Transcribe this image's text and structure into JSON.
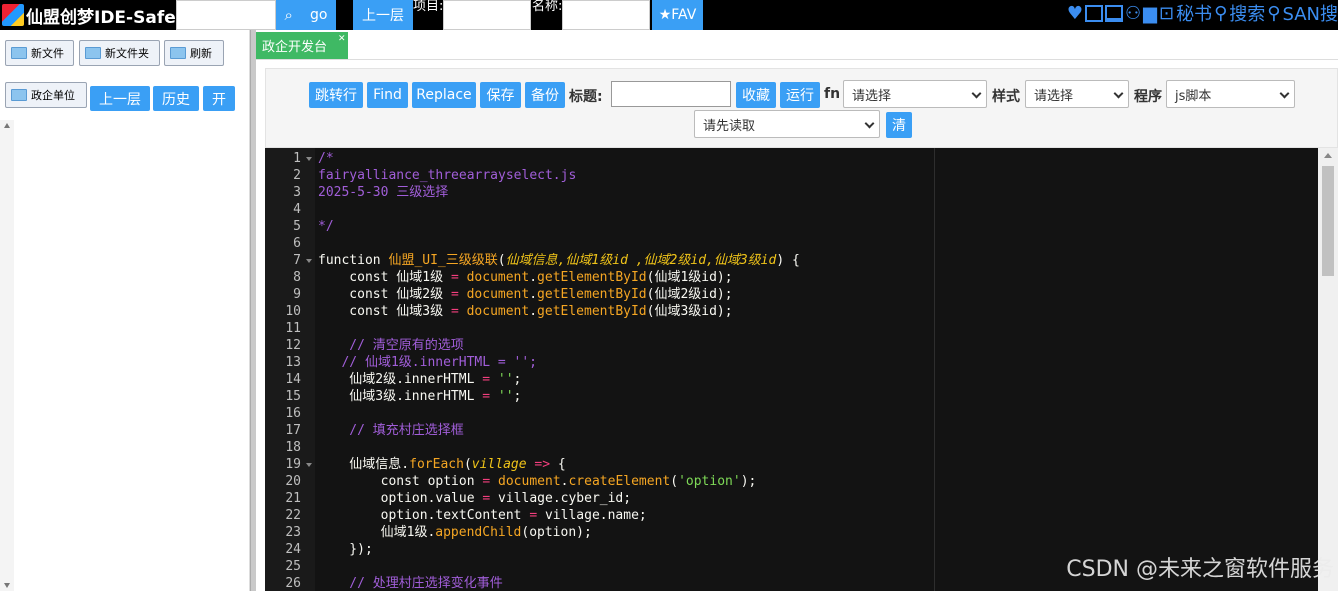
{
  "app": {
    "brand": "仙盟创梦IDE-Safe",
    "search_btn": "go",
    "up_btn": "上一层",
    "project_label": "项目:",
    "name_label": "名称:",
    "fav_btn": "★FAV",
    "right_icons": [
      "heart-icon",
      "panel-icon",
      "window-icon",
      "user-icon",
      "folder-icon",
      "briefcase-icon"
    ],
    "secret_book": "秘书",
    "search_link": "搜索",
    "san_search": "SAN搜"
  },
  "left": {
    "new_file": "新文件",
    "new_folder": "新文件夹",
    "refresh": "刷新",
    "unit": "政企单位",
    "up": "上一层",
    "history": "历史",
    "open": "开"
  },
  "tabs": [
    {
      "label": "政企开发台"
    }
  ],
  "toolbar": {
    "goto": "跳转行",
    "find": "Find",
    "replace": "Replace",
    "save": "保存",
    "backup": "备份",
    "title_label": "标题:",
    "collect": "收藏",
    "run": "运行",
    "fn_label": "fn",
    "fn_select": "请选择",
    "style_label": "样式",
    "style_select": "请选择",
    "program_label": "程序",
    "program_select": "js脚本",
    "read_select": "请先读取",
    "clear": "清"
  },
  "editor": {
    "lines": [
      {
        "n": "1",
        "t": [
          [
            "cm",
            "/*"
          ]
        ]
      },
      {
        "n": "2",
        "t": [
          [
            "cm",
            "fairyalliance_threearrayselect.js"
          ]
        ]
      },
      {
        "n": "3",
        "t": [
          [
            "cm",
            "2025-5-30 三级选择"
          ]
        ]
      },
      {
        "n": "4",
        "t": [
          [
            "cm",
            ""
          ]
        ]
      },
      {
        "n": "5",
        "t": [
          [
            "cm",
            "*/"
          ]
        ]
      },
      {
        "n": "6",
        "t": []
      },
      {
        "n": "7",
        "t": [
          [
            "kw",
            "function "
          ],
          [
            "fn",
            "仙盟_UI_三级级联"
          ],
          [
            "kw",
            "("
          ],
          [
            "pa",
            "仙域信息,仙域1级id ,仙域2级id,仙域3级id"
          ],
          [
            "kw",
            ") {"
          ]
        ]
      },
      {
        "n": "8",
        "t": [
          [
            "kw",
            "    const "
          ],
          [
            "vr",
            "仙域1级 "
          ],
          [
            "op",
            "= "
          ],
          [
            "fn",
            "document"
          ],
          [
            "kw",
            "."
          ],
          [
            "fn",
            "getElementById"
          ],
          [
            "kw",
            "(仙域1级id);"
          ]
        ]
      },
      {
        "n": "9",
        "t": [
          [
            "kw",
            "    const "
          ],
          [
            "vr",
            "仙域2级 "
          ],
          [
            "op",
            "= "
          ],
          [
            "fn",
            "document"
          ],
          [
            "kw",
            "."
          ],
          [
            "fn",
            "getElementById"
          ],
          [
            "kw",
            "(仙域2级id);"
          ]
        ]
      },
      {
        "n": "10",
        "t": [
          [
            "kw",
            "    const "
          ],
          [
            "vr",
            "仙域3级 "
          ],
          [
            "op",
            "= "
          ],
          [
            "fn",
            "document"
          ],
          [
            "kw",
            "."
          ],
          [
            "fn",
            "getElementById"
          ],
          [
            "kw",
            "(仙域3级id);"
          ]
        ]
      },
      {
        "n": "11",
        "t": []
      },
      {
        "n": "12",
        "t": [
          [
            "cm",
            "    // 清空原有的选项"
          ]
        ]
      },
      {
        "n": "13",
        "t": [
          [
            "cm",
            "   // 仙域1级.innerHTML = '';"
          ]
        ]
      },
      {
        "n": "14",
        "t": [
          [
            "vr",
            "    仙域2级.innerHTML "
          ],
          [
            "op",
            "= "
          ],
          [
            "st",
            "''"
          ],
          [
            "kw",
            ";"
          ]
        ]
      },
      {
        "n": "15",
        "t": [
          [
            "vr",
            "    仙域3级.innerHTML "
          ],
          [
            "op",
            "= "
          ],
          [
            "st",
            "''"
          ],
          [
            "kw",
            ";"
          ]
        ]
      },
      {
        "n": "16",
        "t": []
      },
      {
        "n": "17",
        "t": [
          [
            "cm",
            "    // 填充村庄选择框"
          ]
        ]
      },
      {
        "n": "18",
        "t": []
      },
      {
        "n": "19",
        "t": [
          [
            "vr",
            "    仙域信息."
          ],
          [
            "fn",
            "forEach"
          ],
          [
            "kw",
            "("
          ],
          [
            "pa",
            "village"
          ],
          [
            "op",
            " => "
          ],
          [
            "kw",
            "{"
          ]
        ]
      },
      {
        "n": "20",
        "t": [
          [
            "kw",
            "        const "
          ],
          [
            "vr",
            "option "
          ],
          [
            "op",
            "= "
          ],
          [
            "fn",
            "document"
          ],
          [
            "kw",
            "."
          ],
          [
            "fn",
            "createElement"
          ],
          [
            "kw",
            "("
          ],
          [
            "st",
            "'option'"
          ],
          [
            "kw",
            ");"
          ]
        ]
      },
      {
        "n": "21",
        "t": [
          [
            "vr",
            "        option.value "
          ],
          [
            "op",
            "= "
          ],
          [
            "vr",
            "village.cyber_id;"
          ]
        ]
      },
      {
        "n": "22",
        "t": [
          [
            "vr",
            "        option.textContent "
          ],
          [
            "op",
            "= "
          ],
          [
            "vr",
            "village.name;"
          ]
        ]
      },
      {
        "n": "23",
        "t": [
          [
            "vr",
            "        仙域1级."
          ],
          [
            "fn",
            "appendChild"
          ],
          [
            "kw",
            "(option);"
          ]
        ]
      },
      {
        "n": "24",
        "t": [
          [
            "kw",
            "    });"
          ]
        ]
      },
      {
        "n": "25",
        "t": []
      },
      {
        "n": "26",
        "t": [
          [
            "cm",
            "    // 处理村庄选择变化事件"
          ]
        ]
      }
    ],
    "folds": [
      "1",
      "7",
      "19"
    ]
  },
  "watermark": "CSDN @未来之窗软件服务"
}
